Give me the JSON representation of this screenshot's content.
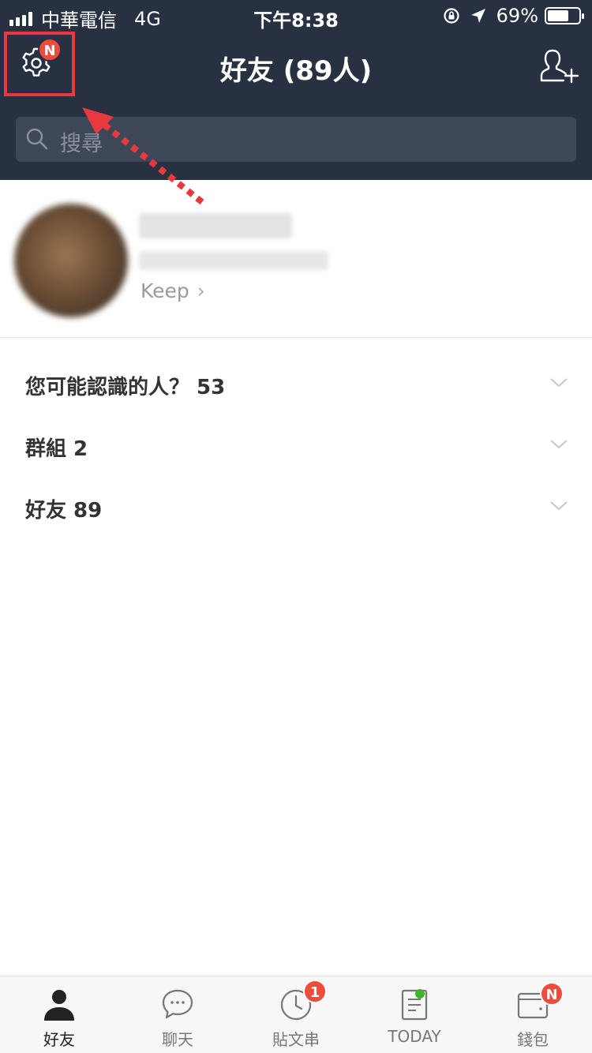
{
  "status_bar": {
    "carrier": "中華電信",
    "network": "4G",
    "time": "下午8:38",
    "battery_text": "69%",
    "battery_level": 0.69
  },
  "header": {
    "title": "好友 (89人)",
    "settings_badge": "N",
    "settings_icon": "gear-icon",
    "add_friend_icon": "add-friend-icon",
    "background_color": "#283142",
    "highlight_color": "#e8393f"
  },
  "search": {
    "placeholder": "搜尋"
  },
  "profile": {
    "keep_label": "Keep",
    "keep_chevron": "›"
  },
  "sections": [
    {
      "label": "您可能認識的人？ 53"
    },
    {
      "label": "群組 2"
    },
    {
      "label": "好友 89"
    }
  ],
  "tabbar": {
    "tabs": [
      {
        "label": "好友",
        "icon": "person-icon",
        "active": true
      },
      {
        "label": "聊天",
        "icon": "chat-bubble-icon"
      },
      {
        "label": "貼文串",
        "icon": "clock-icon",
        "badge": "1"
      },
      {
        "label": "TODAY",
        "icon": "document-icon",
        "dot": true
      },
      {
        "label": "錢包",
        "icon": "wallet-icon",
        "badge": "N"
      }
    ],
    "badge_color": "#ef4b3a",
    "dot_color": "#3fb12b"
  }
}
